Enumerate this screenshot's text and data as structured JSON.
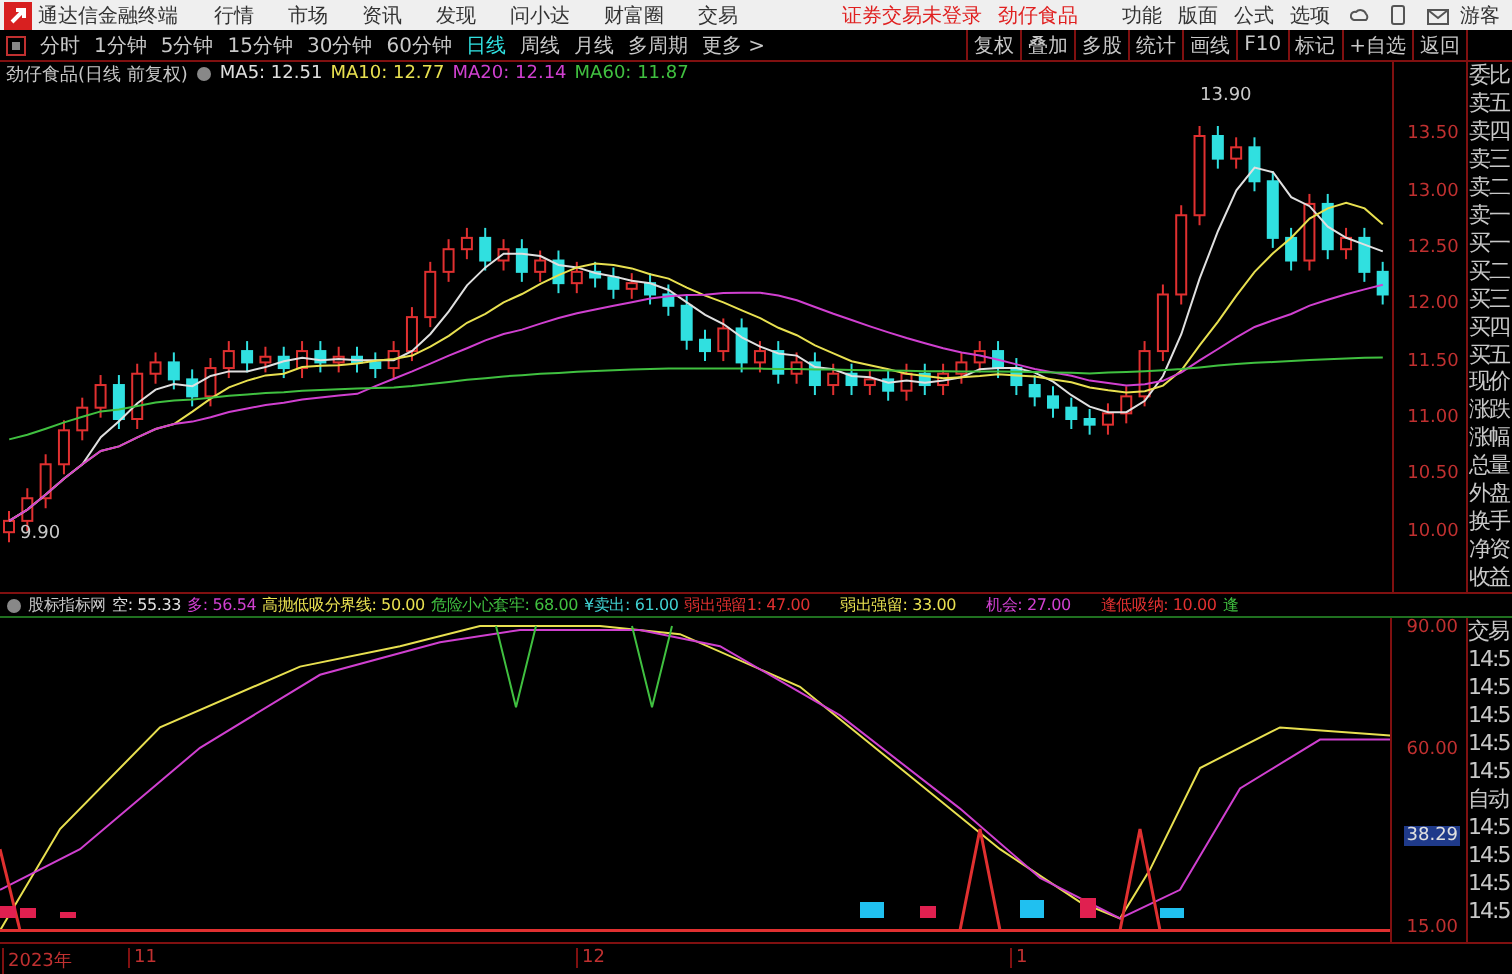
{
  "app": {
    "title": "通达信金融终端",
    "menu": [
      "行情",
      "市场",
      "资讯",
      "发现",
      "问小达",
      "财富圈",
      "交易"
    ],
    "login_notice": "证券交易未登录",
    "stock_name": "劲仔食品",
    "right_menu": [
      "功能",
      "版面",
      "公式",
      "选项"
    ],
    "user": "游客"
  },
  "periods": [
    {
      "label": "分时",
      "selected": false
    },
    {
      "label": "1分钟",
      "selected": false
    },
    {
      "label": "5分钟",
      "selected": false
    },
    {
      "label": "15分钟",
      "selected": false
    },
    {
      "label": "30分钟",
      "selected": false
    },
    {
      "label": "60分钟",
      "selected": false
    },
    {
      "label": "日线",
      "selected": true
    },
    {
      "label": "周线",
      "selected": false
    },
    {
      "label": "月线",
      "selected": false
    },
    {
      "label": "多周期",
      "selected": false
    },
    {
      "label": "更多 >",
      "selected": false
    }
  ],
  "toolbar": [
    "复权",
    "叠加",
    "多股",
    "统计",
    "画线",
    "F10",
    "标记",
    "+自选",
    "返回"
  ],
  "price_chart": {
    "title": "劲仔食品(日线 前复权)",
    "indicators": [
      {
        "label": "MA5: 12.51",
        "color": "#e0e0e0"
      },
      {
        "label": "MA10: 12.77",
        "color": "#e8e050"
      },
      {
        "label": "MA20: 12.14",
        "color": "#d040d0"
      },
      {
        "label": "MA60: 11.87",
        "color": "#40c040"
      }
    ],
    "high_label": "13.90",
    "low_label": "9.90",
    "axis_labels": [
      "13.50",
      "13.00",
      "12.50",
      "12.00",
      "11.50",
      "11.00",
      "10.50",
      "10.00"
    ]
  },
  "indicator_chart": {
    "name": "股标指标网",
    "values": [
      {
        "label": "空: 55.33",
        "color": "#e0e0e0"
      },
      {
        "label": "多: 56.54",
        "color": "#d040d0"
      },
      {
        "label": "高抛低吸分界线: 50.00",
        "color": "#e8e050"
      },
      {
        "label": "危险小心套牢: 68.00",
        "color": "#40c040"
      },
      {
        "label": "¥卖出: 61.00",
        "color": "#40d0d0"
      },
      {
        "label": "弱出强留1: 47.00",
        "color": "#e03030"
      },
      {
        "label": "弱出强留: 33.00",
        "color": "#e8e050"
      },
      {
        "label": "机会: 27.00",
        "color": "#d040d0"
      },
      {
        "label": "逢低吸纳: 10.00",
        "color": "#e03030"
      },
      {
        "label": "逢",
        "color": "#40c040"
      }
    ],
    "axis_labels": [
      {
        "label": "90.00",
        "highlighted": false
      },
      {
        "label": "60.00",
        "highlighted": false
      },
      {
        "label": "38.29",
        "highlighted": true
      },
      {
        "label": "15.00",
        "highlighted": false
      }
    ]
  },
  "quote_panel": {
    "labels": [
      "委比",
      "卖五",
      "卖四",
      "卖三",
      "卖二",
      "卖一",
      "买一",
      "买二",
      "买三",
      "买四",
      "买五",
      "现价",
      "涨跌",
      "涨幅",
      "总量",
      "外盘",
      "换手",
      "净资",
      "收益"
    ]
  },
  "trade_panel": {
    "labels": [
      "交易",
      "14:5",
      "14:5",
      "14:5",
      "14:5",
      "14:5",
      "自动",
      "14:5",
      "14:5",
      "14:5",
      "14:5"
    ]
  },
  "date_axis": [
    "2023年",
    "11",
    "12",
    "1"
  ]
}
